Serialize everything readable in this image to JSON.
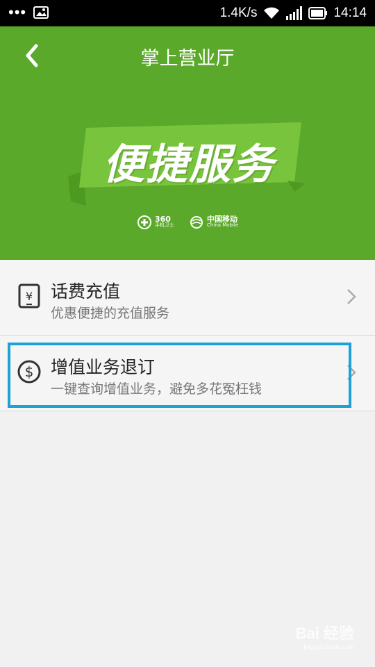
{
  "status_bar": {
    "network_speed": "1.4K/s",
    "time": "14:14",
    "icons": [
      "more-dots-icon",
      "image-notification-icon",
      "wifi-icon",
      "signal-icon",
      "battery-icon"
    ]
  },
  "header": {
    "title": "掌上营业厅",
    "banner_text": "便捷服务",
    "logos": [
      {
        "main": "360",
        "sub": "手机卫士"
      },
      {
        "main": "中国移动",
        "sub": "China Mobile"
      }
    ],
    "background_color": "#5ba92a"
  },
  "list": [
    {
      "title": "话费充值",
      "subtitle": "优惠便捷的充值服务",
      "icon": "phone-yuan-icon"
    },
    {
      "title": "增值业务退订",
      "subtitle": "一键查询增值业务，避免多花冤枉钱",
      "icon": "dollar-coin-icon"
    }
  ],
  "highlight_color": "#1ea2d6",
  "watermark": {
    "text": "Bai 经验",
    "sub": "jingyan.baidu.com"
  }
}
